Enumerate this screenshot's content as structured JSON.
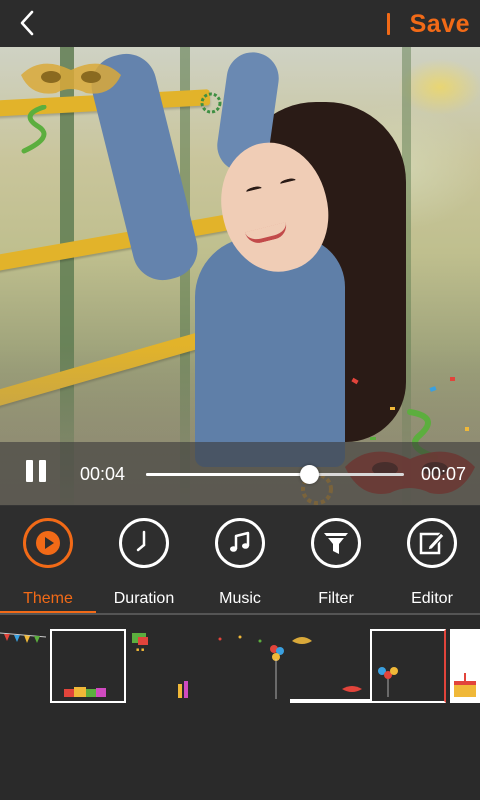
{
  "header": {
    "back_icon": "chevron-left-icon",
    "save_label": "Save",
    "accent": "#f26a17"
  },
  "player": {
    "current_time": "00:04",
    "total_time": "00:07",
    "progress": 0.63,
    "state_icon": "pause-icon"
  },
  "tabs": [
    {
      "label": "Theme",
      "icon": "play-circle-icon",
      "active": true
    },
    {
      "label": "Duration",
      "icon": "clock-icon",
      "active": false
    },
    {
      "label": "Music",
      "icon": "music-note-icon",
      "active": false
    },
    {
      "label": "Filter",
      "icon": "funnel-icon",
      "active": false
    },
    {
      "label": "Editor",
      "icon": "edit-icon",
      "active": false
    }
  ],
  "themes": {
    "selected_index": 1,
    "items": [
      "bunting-theme",
      "gift-boxes-theme",
      "confetti-theme",
      "masks-theme",
      "balloons-theme",
      "cake-theme"
    ]
  }
}
